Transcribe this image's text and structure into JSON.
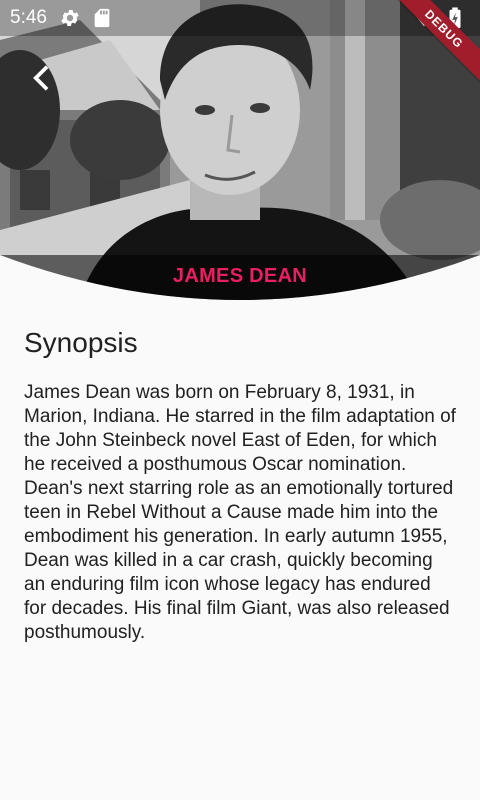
{
  "status_bar": {
    "time": "5:46",
    "left_icons": [
      "gear-icon",
      "sd-card-icon"
    ],
    "right_icons": [
      "wifi-icon",
      "battery-charging-icon"
    ]
  },
  "debug_banner": {
    "label": "DEBUG",
    "color": "#a11d2b"
  },
  "header": {
    "back_icon": "chevron-left-icon",
    "photo_alt": "James Dean portrait",
    "name": "JAMES DEAN",
    "name_color": "#e91e63"
  },
  "synopsis": {
    "title": "Synopsis",
    "body": "James Dean was born on February 8, 1931, in Marion, Indiana. He starred in the film adaptation of the John Steinbeck novel East of Eden, for which he received a posthumous Oscar nomination. Dean's next starring role as an emotionally tortured teen in Rebel Without a Cause made him into the embodiment his generation. In early autumn 1955, Dean was killed in a car crash, quickly becoming an enduring film icon whose legacy has endured for decades. His final film Giant, was also released posthumously."
  }
}
